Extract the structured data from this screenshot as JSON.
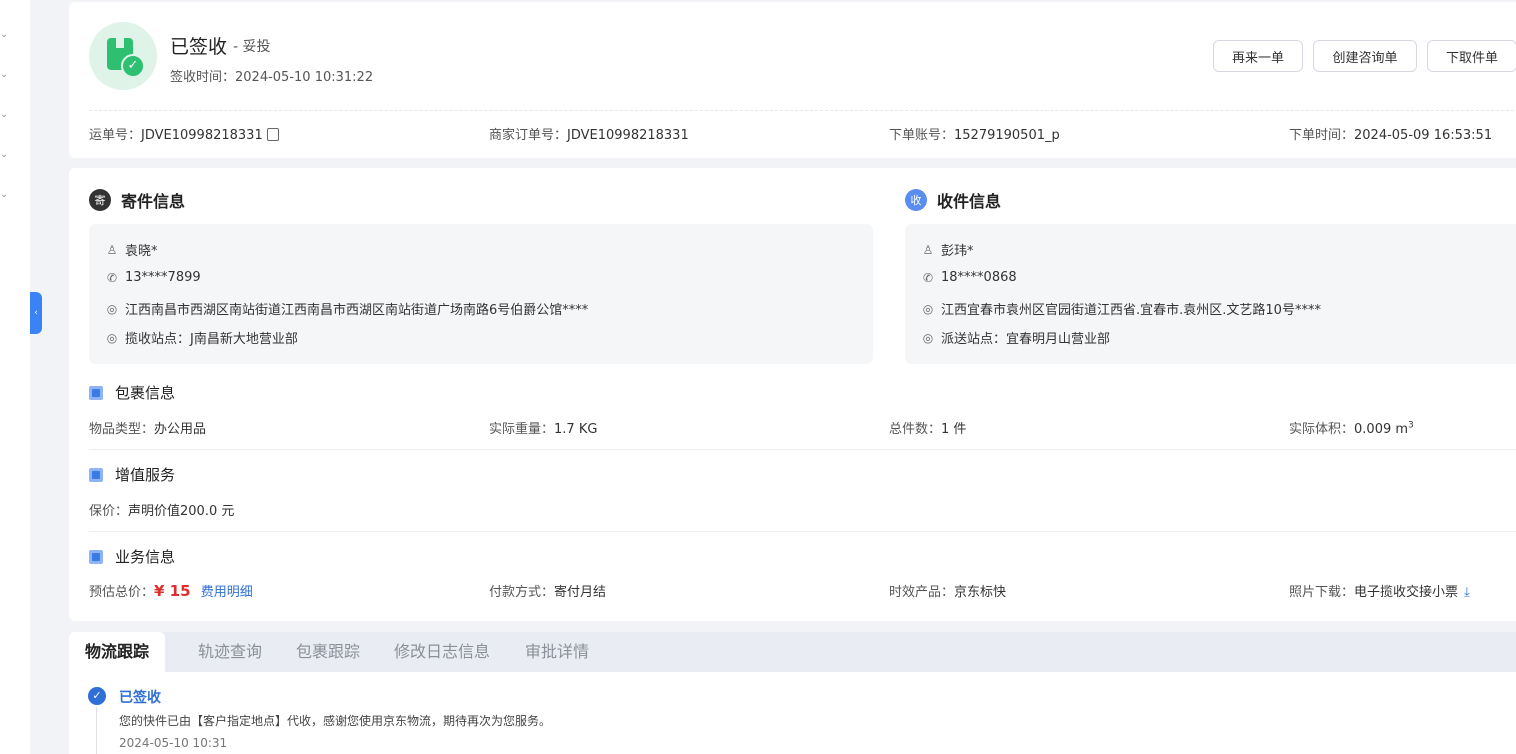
{
  "status": {
    "title": "已签收",
    "subtitle": "- 妥投",
    "sign_time_label": "签收时间：",
    "sign_time": "2024-05-10 10:31:22"
  },
  "actions": {
    "reorder": "再来一单",
    "create_inquiry": "创建咨询单",
    "pickup": "下取件单"
  },
  "order_meta": {
    "waybill_label": "运单号：",
    "waybill": "JDVE10998218331",
    "merchant_order_label": "商家订单号：",
    "merchant_order": "JDVE10998218331",
    "account_label": "下单账号：",
    "account": "15279190501_p",
    "order_time_label": "下单时间：",
    "order_time": "2024-05-09 16:53:51"
  },
  "sender": {
    "badge": "寄",
    "title": "寄件信息",
    "name": "袁晓*",
    "phone": "13****7899",
    "address": "江西南昌市西湖区南站街道江西南昌市西湖区南站街道广场南路6号伯爵公馆****",
    "station": "揽收站点：J南昌新大地营业部"
  },
  "receiver": {
    "badge": "收",
    "title": "收件信息",
    "name": "彭玮*",
    "phone": "18****0868",
    "address": "江西宜春市袁州区官园街道江西省.宜春市.袁州区.文艺路10号****",
    "station": "派送站点：宜春明月山营业部"
  },
  "package": {
    "title": "包裹信息",
    "type_label": "物品类型：",
    "type": "办公用品",
    "weight_label": "实际重量：",
    "weight": "1.7 KG",
    "count_label": "总件数：",
    "count": "1 件",
    "volume_label": "实际体积：",
    "volume": "0.009 m",
    "volume_sup": "3"
  },
  "value_added": {
    "title": "增值服务",
    "insurance_label": "保价：",
    "insurance": "声明价值200.0 元"
  },
  "business": {
    "title": "业务信息",
    "price_label": "预估总价：",
    "price": "¥ 15",
    "fee_detail": "费用明细",
    "payment_label": "付款方式：",
    "payment": "寄付月结",
    "product_label": "时效产品：",
    "product": "京东标快",
    "photo_label": "照片下载：",
    "photo": "电子揽收交接小票"
  },
  "tracking": {
    "tabs": [
      "物流跟踪",
      "轨迹查询",
      "包裹跟踪",
      "修改日志信息",
      "审批详情"
    ],
    "event_title": "已签收",
    "event_desc": "您的快件已由【客户指定地点】代收，感谢您使用京东物流，期待再次为您服务。",
    "event_time": "2024-05-10 10:31"
  },
  "colors": {
    "accent": "#2f6fd6",
    "success": "#2fbf71",
    "price": "#e02d2d"
  }
}
